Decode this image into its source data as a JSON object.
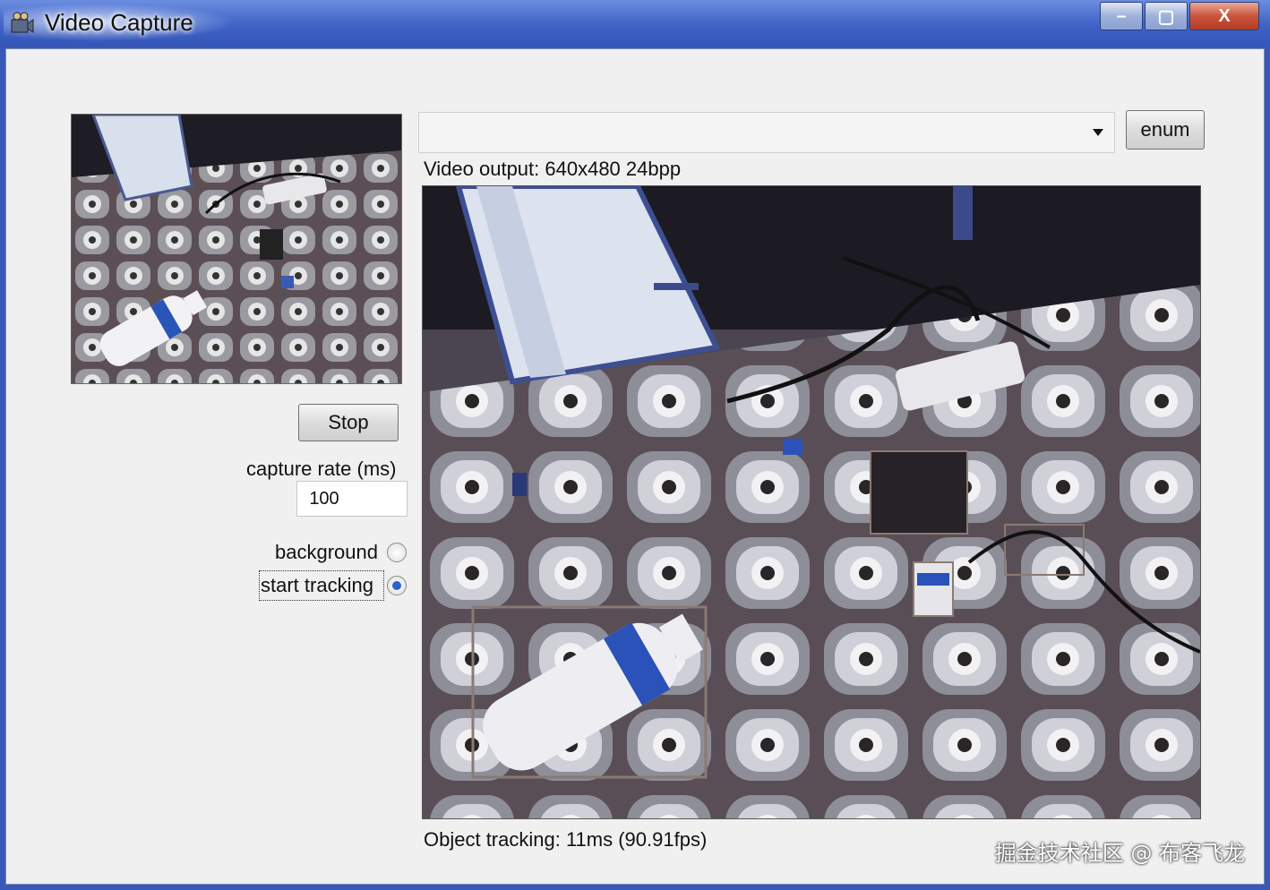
{
  "window": {
    "title": "Video Capture",
    "controls": {
      "minimize": "–",
      "maximize": "▢",
      "close": "X"
    }
  },
  "device_combo": {
    "selected": ""
  },
  "enum_button": {
    "label": "enum"
  },
  "stop_button": {
    "label": "Stop"
  },
  "capture_rate": {
    "label": "capture rate (ms)",
    "value": "100"
  },
  "mode": {
    "options": [
      {
        "label": "background",
        "selected": false
      },
      {
        "label": "start tracking",
        "selected": true
      }
    ]
  },
  "video": {
    "output_label": "Video output: 640x480 24bpp",
    "tracking_status": "Object tracking: 11ms (90.91fps)"
  },
  "watermark": "掘金技术社区 @ 布客飞龙"
}
